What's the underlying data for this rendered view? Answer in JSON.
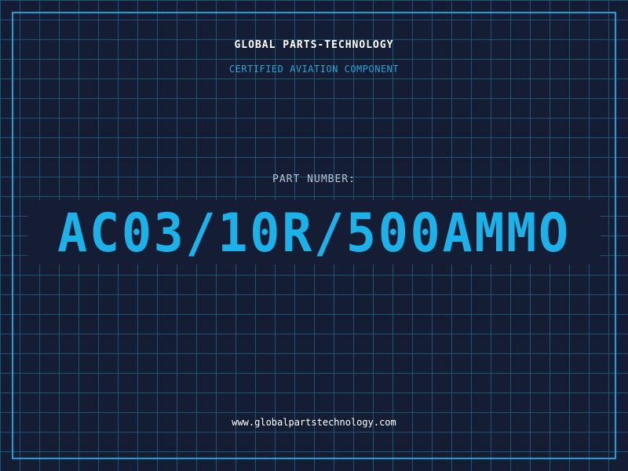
{
  "header": {
    "company": "GLOBAL PARTS-TECHNOLOGY",
    "subtitle": "CERTIFIED AVIATION COMPONENT"
  },
  "part": {
    "label": "PART NUMBER:",
    "number": "AC03/10R/500AMMO"
  },
  "footer": {
    "url": "www.globalpartstechnology.com"
  },
  "colors": {
    "background": "#151d35",
    "grid": "#1b5573",
    "accent": "#1ab2e8",
    "frame": "#1f9fd4"
  }
}
